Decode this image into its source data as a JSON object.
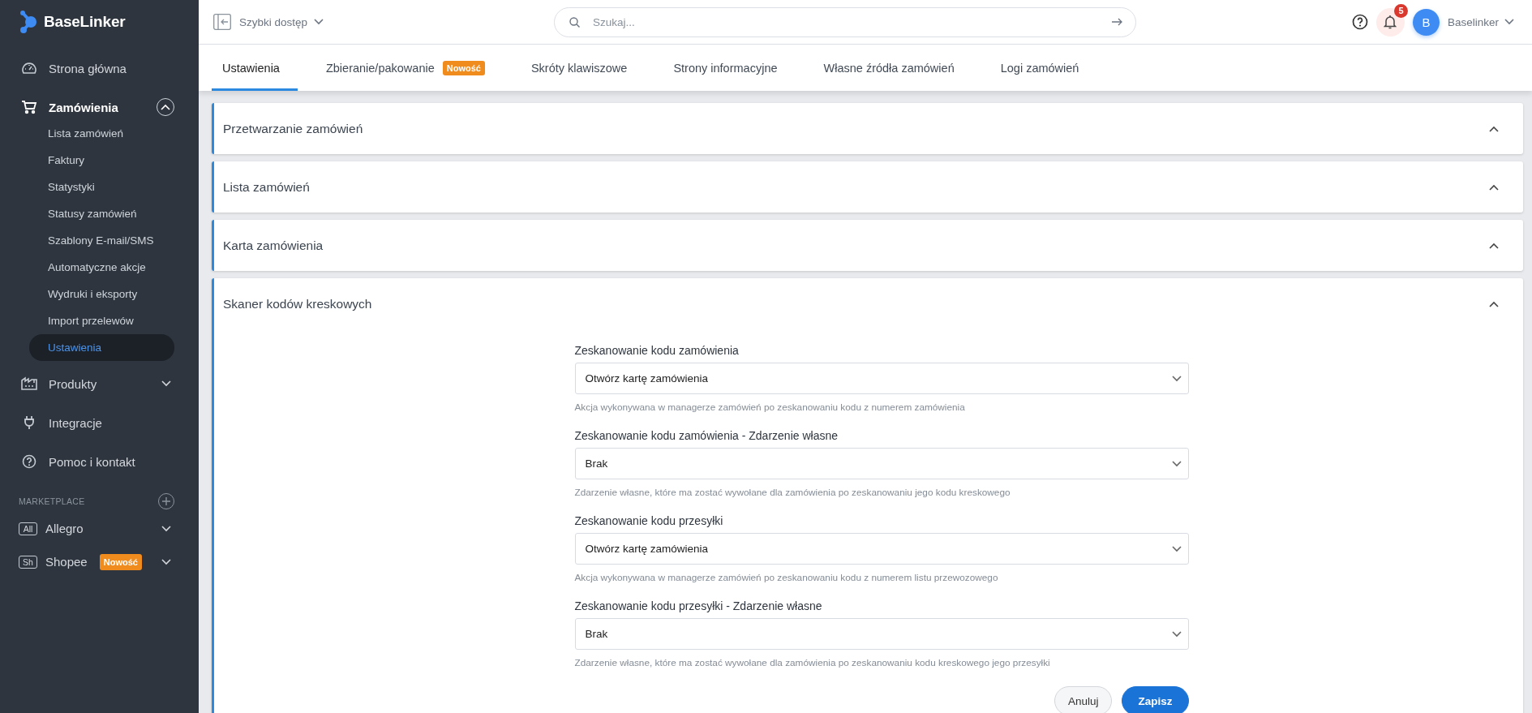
{
  "sidebar": {
    "logo": "BaseLinker",
    "nav": [
      {
        "label": "Strona główna",
        "kind": "link"
      },
      {
        "label": "Zamówienia",
        "kind": "group",
        "expanded": true,
        "children": [
          {
            "label": "Lista zamówień",
            "selected": false
          },
          {
            "label": "Faktury",
            "selected": false
          },
          {
            "label": "Statystyki",
            "selected": false
          },
          {
            "label": "Statusy zamówień",
            "selected": false
          },
          {
            "label": "Szablony E-mail/SMS",
            "selected": false
          },
          {
            "label": "Automatyczne akcje",
            "selected": false
          },
          {
            "label": "Wydruki i eksporty",
            "selected": false
          },
          {
            "label": "Import przelewów",
            "selected": false
          },
          {
            "label": "Ustawienia",
            "selected": true
          }
        ]
      },
      {
        "label": "Produkty",
        "kind": "group",
        "expanded": false
      },
      {
        "label": "Integracje",
        "kind": "link"
      },
      {
        "label": "Pomoc i kontakt",
        "kind": "link"
      }
    ],
    "marketplace": {
      "heading": "MARKETPLACE",
      "items": [
        {
          "abbr": "All",
          "label": "Allegro",
          "expanded": false
        },
        {
          "abbr": "Sh",
          "label": "Shopee",
          "badge": "Nowość",
          "expanded": false
        }
      ]
    }
  },
  "topbar": {
    "quick_access": "Szybki dostęp",
    "search": {
      "placeholder": "Szukaj..."
    },
    "notifications": "5",
    "user": {
      "initial": "B",
      "name": "Baselinker"
    }
  },
  "tabs": [
    {
      "label": "Ustawienia",
      "selected": true
    },
    {
      "label": "Zbieranie/pakowanie",
      "badge": "Nowość",
      "selected": false
    },
    {
      "label": "Skróty klawiszowe",
      "selected": false
    },
    {
      "label": "Strony informacyjne",
      "selected": false
    },
    {
      "label": "Własne źródła zamówień",
      "selected": false
    },
    {
      "label": "Logi zamówień",
      "selected": false
    }
  ],
  "sections": [
    {
      "title": "Przetwarzanie zamówień"
    },
    {
      "title": "Lista zamówień"
    },
    {
      "title": "Karta zamówienia"
    },
    {
      "title": "Skaner kodów kreskowych",
      "fields": [
        {
          "label": "Zeskanowanie kodu zamówienia",
          "value": "Otwórz kartę zamówienia",
          "help": "Akcja wykonywana w managerze zamówień po zeskanowaniu kodu z numerem zamówienia"
        },
        {
          "label": "Zeskanowanie kodu zamówienia - Zdarzenie własne",
          "value": "Brak",
          "help": "Zdarzenie własne, które ma zostać wywołane dla zamówienia po zeskanowaniu jego kodu kreskowego"
        },
        {
          "label": "Zeskanowanie kodu przesyłki",
          "value": "Otwórz kartę zamówienia",
          "help": "Akcja wykonywana w managerze zamówień po zeskanowaniu kodu z numerem listu przewozowego"
        },
        {
          "label": "Zeskanowanie kodu przesyłki - Zdarzenie własne",
          "value": "Brak",
          "help": "Zdarzenie własne, które ma zostać wywołane dla zamówienia po zeskanowaniu kodu kreskowego jego przesyłki"
        }
      ],
      "buttons": [
        {
          "label": "Anuluj",
          "kind": "secondary"
        },
        {
          "label": "Zapisz",
          "kind": "primary"
        }
      ]
    }
  ]
}
